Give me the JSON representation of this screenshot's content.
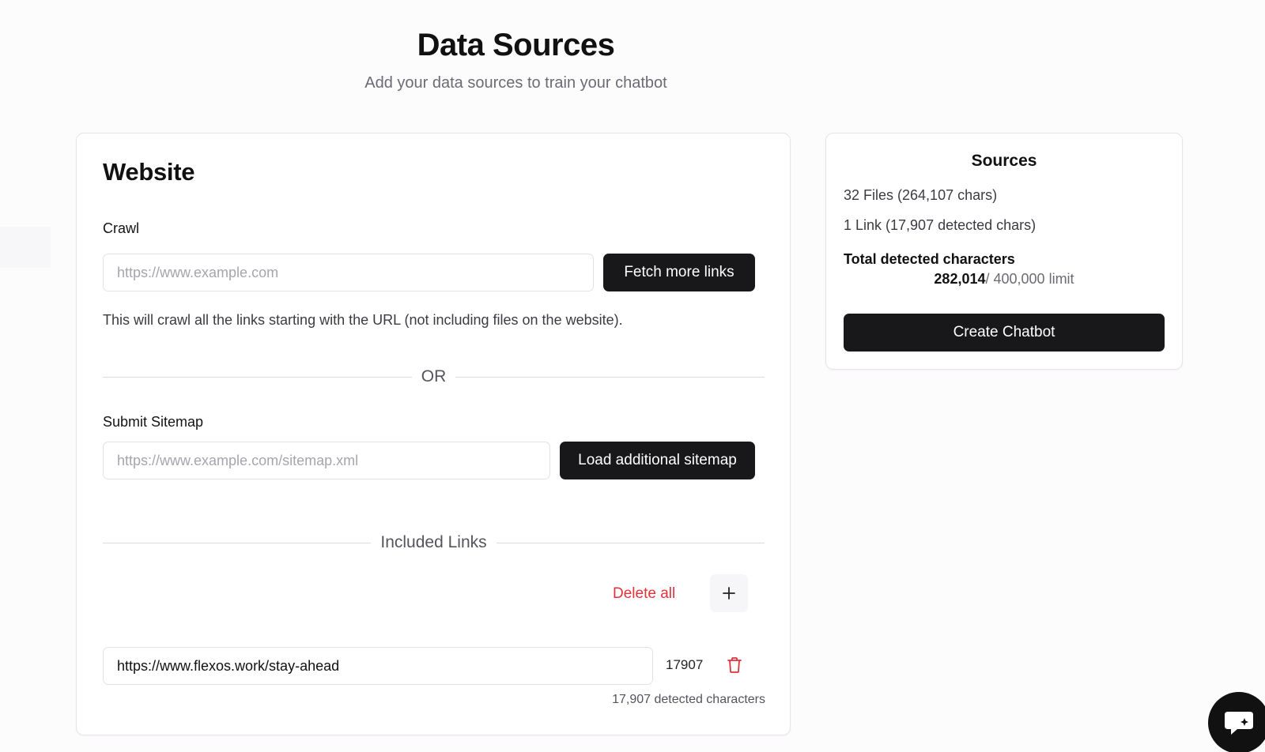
{
  "header": {
    "title": "Data Sources",
    "subtitle": "Add your data sources to train your chatbot"
  },
  "website": {
    "title": "Website",
    "crawl": {
      "label": "Crawl",
      "placeholder": "https://www.example.com",
      "button_label": "Fetch more links",
      "helper_text": "This will crawl all the links starting with the URL (not including files on the website)."
    },
    "or_divider": "OR",
    "sitemap": {
      "label": "Submit Sitemap",
      "placeholder": "https://www.example.com/sitemap.xml",
      "button_label": "Load additional sitemap"
    },
    "included_links": {
      "divider_label": "Included Links",
      "delete_all_label": "Delete all",
      "add_icon": "plus-icon",
      "links": [
        {
          "url": "https://www.flexos.work/stay-ahead",
          "char_count": "17907",
          "delete_icon": "trash-icon"
        }
      ],
      "detected_summary": "17,907 detected characters"
    }
  },
  "sources": {
    "title": "Sources",
    "files_line": "32 Files (264,107 chars)",
    "links_line": "1 Link (17,907 detected chars)",
    "total_label": "Total detected characters",
    "total_value": "282,014",
    "limit_text": "/ 400,000 limit",
    "create_button_label": "Create Chatbot"
  },
  "chat_widget": {
    "icon": "chat-bubble-icon"
  },
  "colors": {
    "primary_dark": "#18181b",
    "danger": "#e0323c",
    "muted_text": "#6b6b74",
    "border": "#e6e4e8"
  }
}
